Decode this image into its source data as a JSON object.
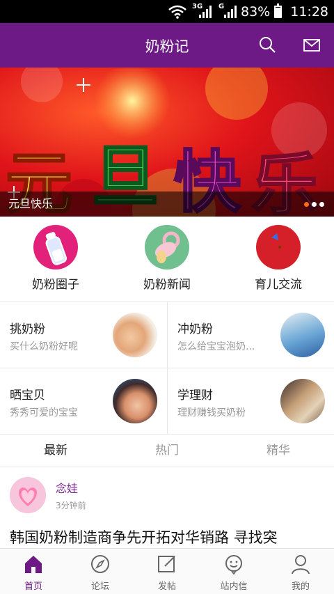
{
  "status_bar": {
    "network_a": "3G",
    "network_b": "G",
    "battery": "83%",
    "time": "11:28"
  },
  "header": {
    "title": "奶粉记",
    "icons": [
      "search-icon",
      "mail-icon"
    ],
    "color": "#6d1a87"
  },
  "banner": {
    "artwork_text": "元旦快乐",
    "caption": "元旦快乐",
    "slide_count": 3,
    "active_slide": 1
  },
  "categories": [
    {
      "label": "奶粉圈子",
      "icon": "baby-bottle-icon",
      "color": "#e2227a"
    },
    {
      "label": "奶粉新闻",
      "icon": "pacifier-icon",
      "color": "#6fbf8f"
    },
    {
      "label": "育儿交流",
      "icon": "moon-icon",
      "color": "#d5202a"
    }
  ],
  "topics": [
    {
      "title": "挑奶粉",
      "subtitle": "买什么奶粉好呢"
    },
    {
      "title": "冲奶粉",
      "subtitle": "怎么给宝宝泡奶..."
    },
    {
      "title": "晒宝贝",
      "subtitle": "秀秀可爱的宝宝"
    },
    {
      "title": "学理财",
      "subtitle": "理财赚钱买奶粉"
    }
  ],
  "feed_tabs": [
    {
      "label": "最新",
      "active": true
    },
    {
      "label": "热门",
      "active": false
    },
    {
      "label": "精华",
      "active": false
    }
  ],
  "post": {
    "author": "念娃",
    "time": "3分钟前",
    "headline": "韩国奶粉制造商争先开拓对华销路 寻找突"
  },
  "bottom_nav": [
    {
      "label": "首页",
      "icon": "home-icon",
      "active": true
    },
    {
      "label": "论坛",
      "icon": "compass-icon",
      "active": false
    },
    {
      "label": "发帖",
      "icon": "compose-icon",
      "active": false
    },
    {
      "label": "站内信",
      "icon": "chat-icon",
      "active": false
    },
    {
      "label": "我的",
      "icon": "profile-icon",
      "active": false
    }
  ]
}
